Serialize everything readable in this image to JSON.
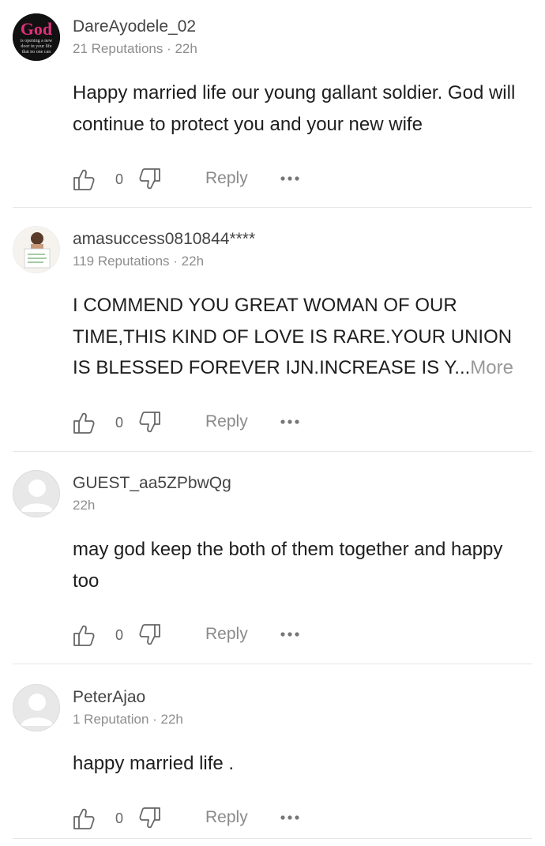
{
  "comments": [
    {
      "username": "DareAyodele_02",
      "meta": "21 Reputations · 22h",
      "text": "Happy married life our young gallant soldier. God will continue to protect you and your new wife",
      "more": "",
      "likes": "0",
      "reply_label": "Reply",
      "avatar_text": [
        "God",
        "is opening a new",
        "door in your life",
        "that no one can"
      ]
    },
    {
      "username": "amasuccess0810844****",
      "meta": "119 Reputations · 22h",
      "text": "I COMMEND YOU GREAT WOMAN OF OUR TIME,THIS KIND OF LOVE IS RARE.YOUR UNION IS BLESSED FOREVER IJN.INCREASE IS Y...",
      "more": "More",
      "likes": "0",
      "reply_label": "Reply"
    },
    {
      "username": "GUEST_aa5ZPbwQg",
      "meta": "22h",
      "text": "may god  keep the both of them together and happy  too",
      "more": "",
      "likes": "0",
      "reply_label": "Reply"
    },
    {
      "username": "PeterAjao",
      "meta": "1 Reputation · 22h",
      "text": "happy married life .",
      "more": "",
      "likes": "0",
      "reply_label": "Reply"
    }
  ],
  "icons": {
    "like": "thumbs-up-icon",
    "dislike": "thumbs-down-icon",
    "more": "more-dots-icon"
  }
}
